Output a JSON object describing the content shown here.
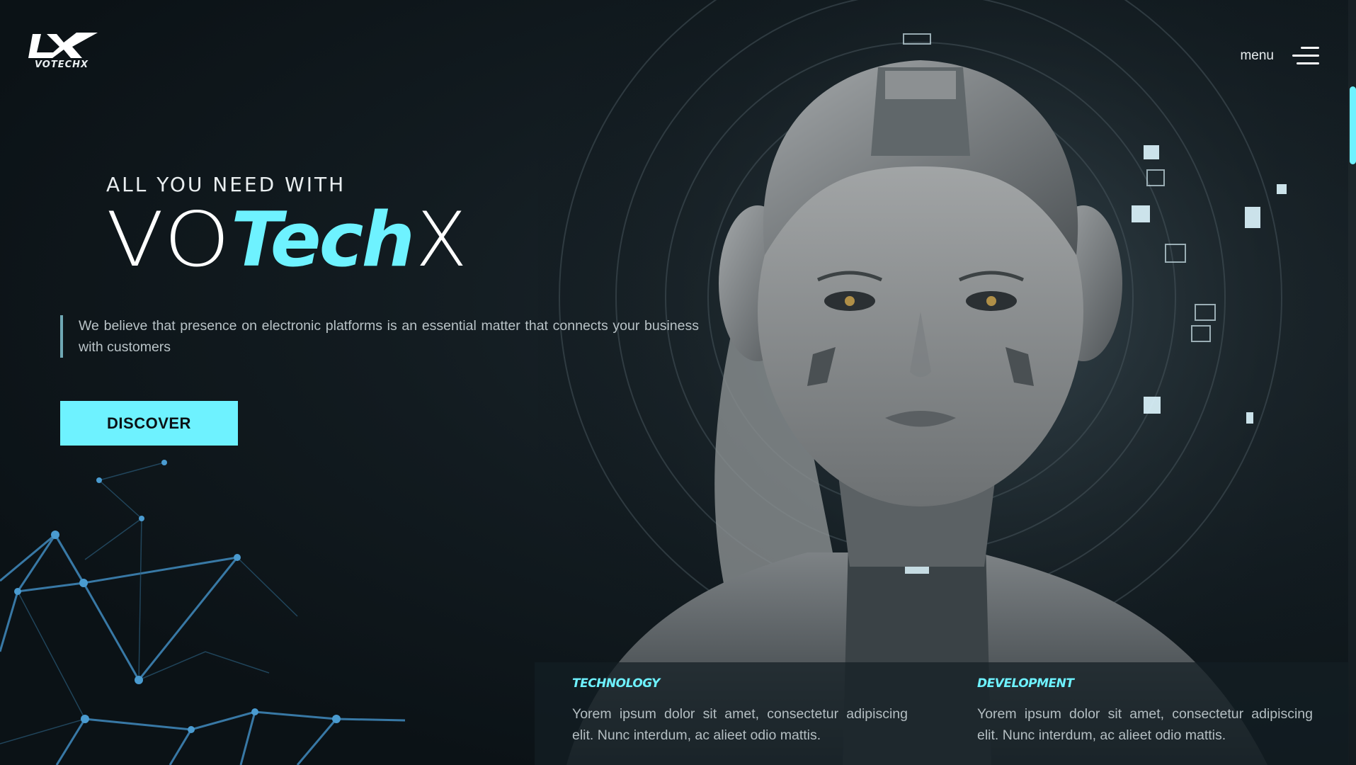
{
  "brand": {
    "logo_text": "VOTECHX",
    "eyebrow": "ALL YOU NEED WITH",
    "name_part1": "VO",
    "name_part2": "Tech",
    "name_part3": "X"
  },
  "header": {
    "menu_label": "menu"
  },
  "hero": {
    "description": "We believe that presence on electronic platforms is an essential matter that connects your business with customers",
    "cta_label": "DISCOVER"
  },
  "info": [
    {
      "title": "TECHNOLOGY",
      "text": "Yorem ipsum dolor sit amet, consectetur adipiscing elit. Nunc interdum, ac alieet odio mattis."
    },
    {
      "title": "DEVELOPMENT",
      "text": "Yorem ipsum dolor sit amet, consectetur adipiscing elit. Nunc interdum, ac alieet odio mattis."
    }
  ],
  "colors": {
    "accent": "#6ef2ff",
    "background": "#0c1419",
    "network_lines": "#3d84b5"
  },
  "icons": {
    "menu": "hamburger-menu-icon",
    "logo": "votechx-logo"
  }
}
